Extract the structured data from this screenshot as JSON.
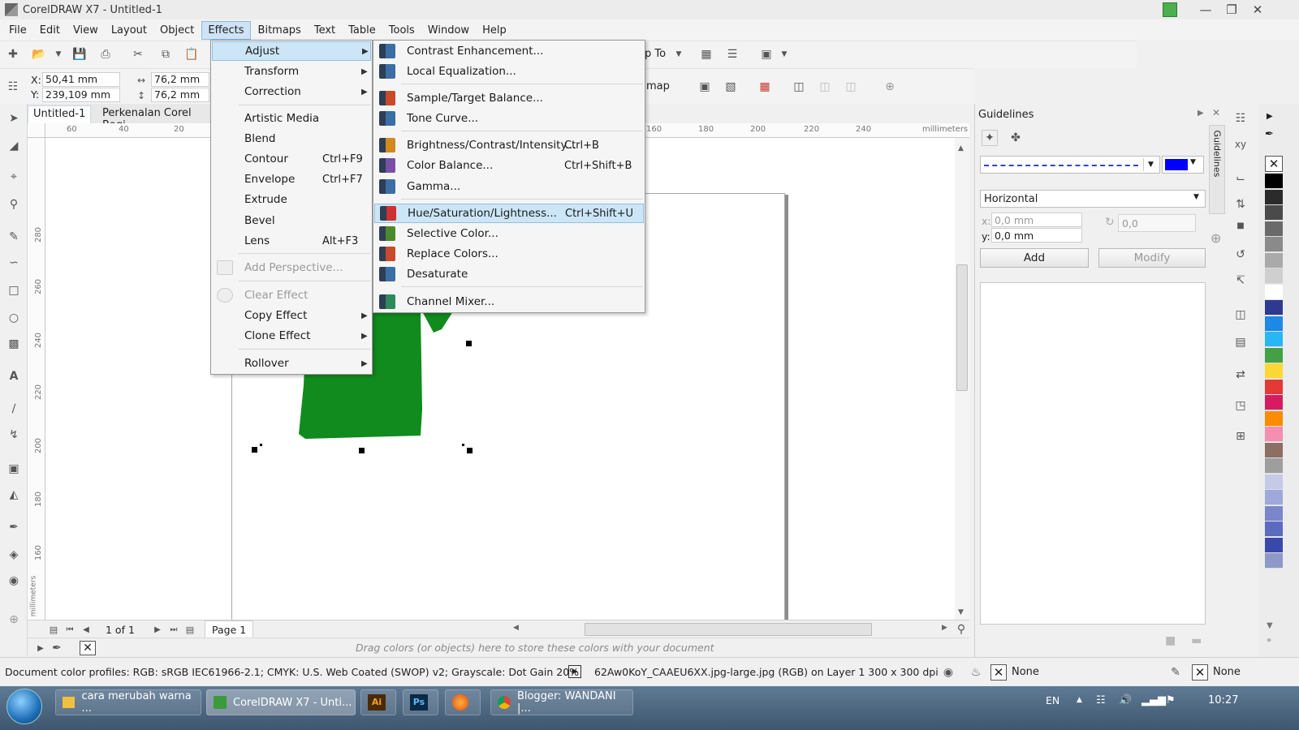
{
  "window": {
    "title": "CorelDRAW X7 - Untitled-1"
  },
  "menubar": [
    "File",
    "Edit",
    "View",
    "Layout",
    "Object",
    "Effects",
    "Bitmaps",
    "Text",
    "Table",
    "Tools",
    "Window",
    "Help"
  ],
  "toolbar": {
    "x_label": "X:",
    "x_value": "50,41 mm",
    "y_label": "Y:",
    "y_value": "239,109 mm",
    "width_value": "76,2 mm",
    "height_value": "76,2 mm",
    "snap_partial": "p To",
    "bitmap_partial": "map"
  },
  "doc_tabs": [
    "Untitled-1",
    "Perkenalan Corel Bagi"
  ],
  "rulers": {
    "h": [
      "60",
      "40",
      "20",
      "160",
      "180",
      "200",
      "220",
      "240"
    ],
    "h_unit": "millimeters",
    "v": [
      "280",
      "260",
      "240",
      "220",
      "200",
      "180",
      "160"
    ],
    "v_unit": "millimeters"
  },
  "effects_menu": [
    {
      "label": "Adjust",
      "shortcut": "",
      "submenu": true,
      "disabled": false,
      "hl": true
    },
    {
      "label": "Transform",
      "shortcut": "",
      "submenu": true,
      "disabled": false
    },
    {
      "label": "Correction",
      "shortcut": "",
      "submenu": true,
      "disabled": false
    },
    {
      "label": "Artistic Media",
      "shortcut": "",
      "submenu": false,
      "disabled": false
    },
    {
      "label": "Blend",
      "shortcut": "",
      "submenu": false,
      "disabled": false
    },
    {
      "label": "Contour",
      "shortcut": "Ctrl+F9",
      "submenu": false,
      "disabled": false
    },
    {
      "label": "Envelope",
      "shortcut": "Ctrl+F7",
      "submenu": false,
      "disabled": false
    },
    {
      "label": "Extrude",
      "shortcut": "",
      "submenu": false,
      "disabled": false
    },
    {
      "label": "Bevel",
      "shortcut": "",
      "submenu": false,
      "disabled": false
    },
    {
      "label": "Lens",
      "shortcut": "Alt+F3",
      "submenu": false,
      "disabled": false
    },
    {
      "label": "Add Perspective...",
      "shortcut": "",
      "submenu": false,
      "disabled": true
    },
    {
      "label": "Clear Effect",
      "shortcut": "",
      "submenu": false,
      "disabled": true
    },
    {
      "label": "Copy Effect",
      "shortcut": "",
      "submenu": true,
      "disabled": false
    },
    {
      "label": "Clone Effect",
      "shortcut": "",
      "submenu": true,
      "disabled": false
    },
    {
      "label": "Rollover",
      "shortcut": "",
      "submenu": true,
      "disabled": false
    }
  ],
  "adjust_menu": [
    {
      "label": "Contrast Enhancement...",
      "shortcut": ""
    },
    {
      "label": "Local Equalization...",
      "shortcut": ""
    },
    {
      "label": "Sample/Target Balance...",
      "shortcut": ""
    },
    {
      "label": "Tone Curve...",
      "shortcut": ""
    },
    {
      "label": "Brightness/Contrast/Intensity...",
      "shortcut": "Ctrl+B"
    },
    {
      "label": "Color Balance...",
      "shortcut": "Ctrl+Shift+B"
    },
    {
      "label": "Gamma...",
      "shortcut": ""
    },
    {
      "label": "Hue/Saturation/Lightness...",
      "shortcut": "Ctrl+Shift+U"
    },
    {
      "label": "Selective Color...",
      "shortcut": ""
    },
    {
      "label": "Replace Colors...",
      "shortcut": ""
    },
    {
      "label": "Desaturate",
      "shortcut": ""
    },
    {
      "label": "Channel Mixer...",
      "shortcut": ""
    }
  ],
  "docker": {
    "title": "Guidelines",
    "tab_label": "Guidelines",
    "orientation": "Horizontal",
    "x_label": "x:",
    "x_value": "0,0 mm",
    "y_label": "y:",
    "y_value": "0,0 mm",
    "angle_value": "0,0",
    "add_label": "Add",
    "modify_label": "Modify",
    "line_color": "#0000ff"
  },
  "pagebar": {
    "page_count": "1 of 1",
    "page_tab": "Page 1"
  },
  "colorbar": {
    "hint": "Drag colors (or objects) here to store these colors with your document"
  },
  "status": {
    "profiles": "Document color profiles: RGB: sRGB IEC61966-2.1; CMYK: U.S. Web Coated (SWOP) v2; Grayscale: Dot Gain 20%",
    "object_info": "62Aw0KoY_CAAEU6XX.jpg-large.jpg (RGB) on Layer 1 300 x 300 dpi",
    "fill_label": "None",
    "outline_label": "None"
  },
  "taskbar": {
    "items": [
      "cara merubah warna ...",
      "CorelDRAW X7 - Unti...",
      "",
      "",
      "",
      "Blogger: WANDANI |..."
    ],
    "lang": "EN",
    "time": "10:27"
  },
  "palette_colors": [
    "#000000",
    "#2b2b2b",
    "#4a4a4a",
    "#6a6a6a",
    "#8a8a8a",
    "#aaaaaa",
    "#cfcfcf",
    "#ffffff",
    "#2e3a8f",
    "#1e88e5",
    "#29b6f6",
    "#43a047",
    "#fdd835",
    "#e53935",
    "#d81b60",
    "#fb8c00",
    "#f48fb1",
    "#8d6e63",
    "#9e9e9e",
    "#c5cae9",
    "#9fa8da",
    "#7986cb",
    "#5c6bc0",
    "#3949ab",
    "#8e99c7"
  ],
  "shirt_color": "#118a1e"
}
